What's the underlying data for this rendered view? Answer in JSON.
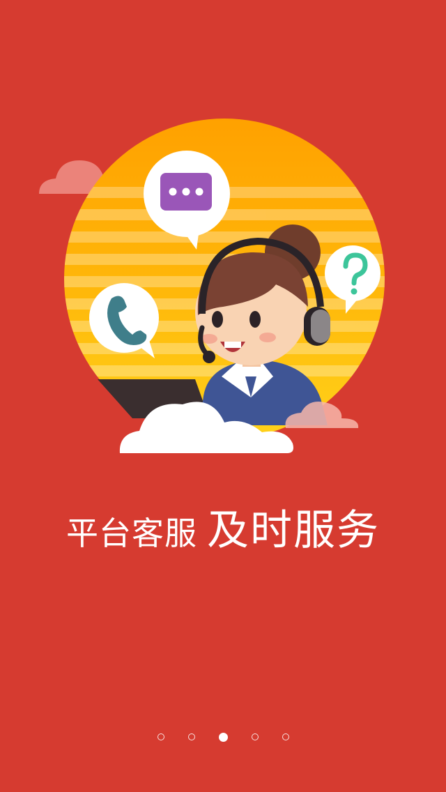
{
  "screen": {
    "name": "onboarding-page",
    "background_color": "#d63b30",
    "accent_sun_color": "#ffb400"
  },
  "illustration": {
    "subject": "customer-service-agent-with-headset",
    "icons": [
      "chat-bubble-icon",
      "phone-icon",
      "question-icon",
      "cloud-icon"
    ]
  },
  "headline": {
    "sub": "平台客服",
    "main": "及时服务"
  },
  "pager": {
    "total": 5,
    "active_index": 2
  }
}
